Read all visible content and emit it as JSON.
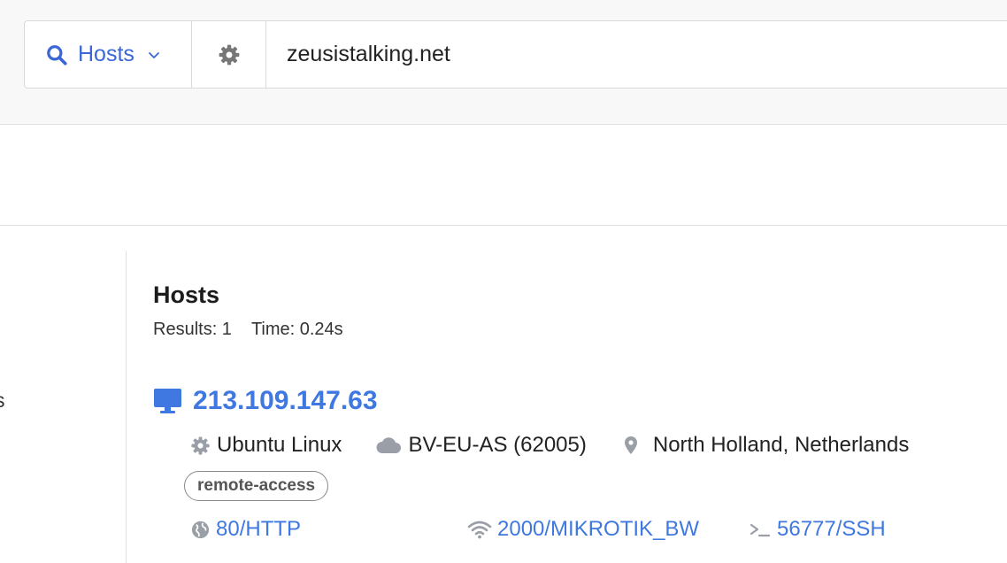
{
  "search": {
    "type_label": "Hosts",
    "query": "zeusistalking.net"
  },
  "sidebar": {
    "partial_text": "s"
  },
  "results": {
    "title": "Hosts",
    "count_text": "Results: 1",
    "time_text": "Time: 0.24s"
  },
  "host": {
    "ip": "213.109.147.63",
    "os": "Ubuntu Linux",
    "asn": "BV-EU-AS (62005)",
    "location": "North Holland, Netherlands",
    "tag": "remote-access",
    "ports": [
      {
        "label": "80/HTTP",
        "icon": "globe-icon"
      },
      {
        "label": "2000/MIKROTIK_BW",
        "icon": "wifi-icon"
      },
      {
        "label": "56777/SSH",
        "icon": "terminal-icon"
      }
    ]
  },
  "colors": {
    "accent": "#3a66d6",
    "link": "#3f78e0",
    "icon_gray": "#9a9ea6"
  }
}
